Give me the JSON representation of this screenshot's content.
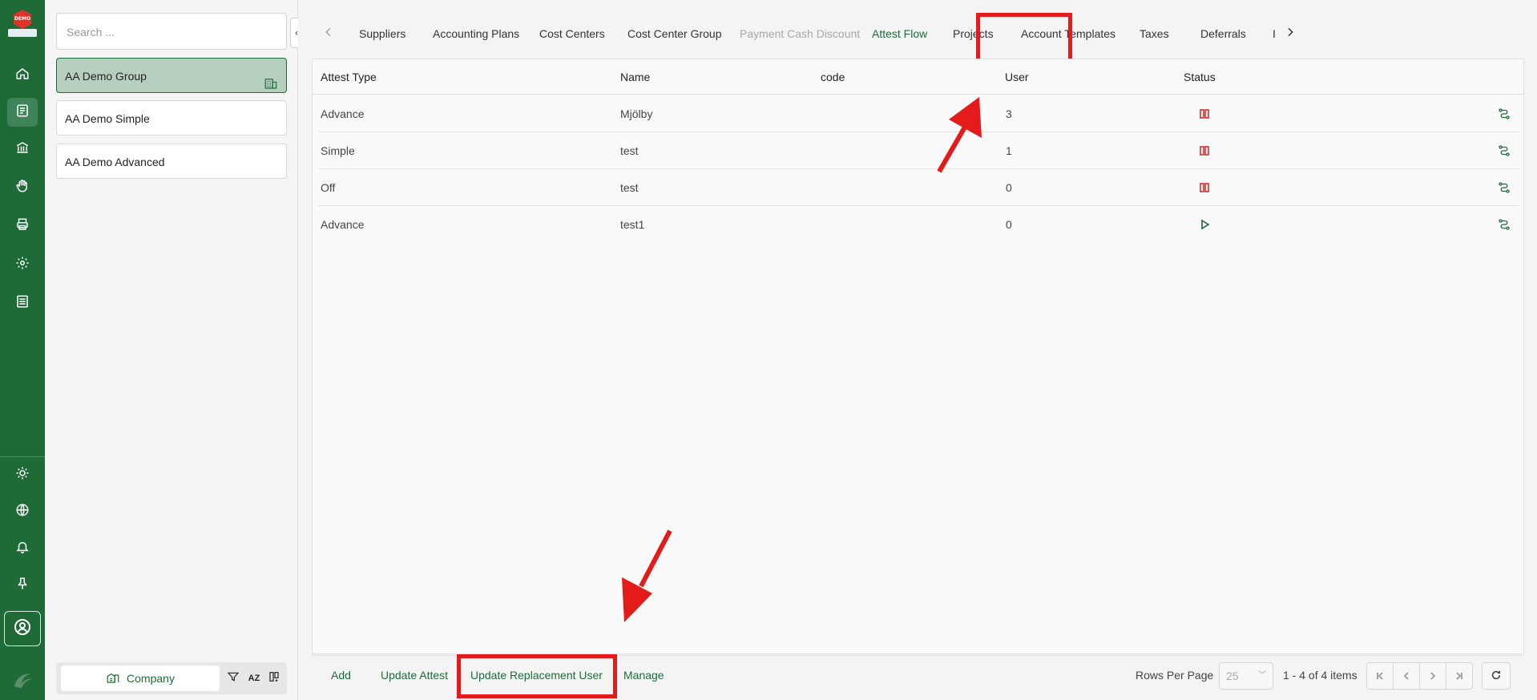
{
  "brand": {
    "logo_text": "DEMO"
  },
  "colors": {
    "brand_green": "#1f6b38",
    "status_off": "#d32f2f",
    "annotation_red": "#e31b1b"
  },
  "nav": {
    "icons": [
      "home-icon",
      "document-icon",
      "bank-icon",
      "hand-icon",
      "printer-icon",
      "gear-icon",
      "list-icon"
    ],
    "bottom_icons": [
      "sun-icon",
      "globe-icon",
      "bell-icon",
      "pin-icon",
      "user-circle-icon",
      "brand-swirl-icon"
    ],
    "active_index": 1
  },
  "sidebar": {
    "search_placeholder": "Search ...",
    "companies": [
      {
        "label": "AA Demo Group",
        "selected": true
      },
      {
        "label": "AA Demo Simple",
        "selected": false
      },
      {
        "label": "AA Demo Advanced",
        "selected": false
      }
    ],
    "footer": {
      "company_label": "Company",
      "sort_label": "AZ"
    }
  },
  "tabs": {
    "items": [
      {
        "label": "Suppliers"
      },
      {
        "label": "Accounting Plans"
      },
      {
        "label": "Cost Centers"
      },
      {
        "label": "Cost Center Group"
      },
      {
        "label": "Payment Cash Discount",
        "disabled": true
      },
      {
        "label": "Attest Flow",
        "active": true
      },
      {
        "label": "Projects"
      },
      {
        "label": "Account Templates"
      },
      {
        "label": "Taxes"
      },
      {
        "label": "Deferrals"
      },
      {
        "label": "I"
      }
    ]
  },
  "grid": {
    "columns": [
      "Attest Type",
      "Name",
      "code",
      "User",
      "Status"
    ],
    "rows": [
      {
        "attest_type": "Advance",
        "name": "Mjölby",
        "code": "",
        "user": "3",
        "status": "paused"
      },
      {
        "attest_type": "Simple",
        "name": "test",
        "code": "",
        "user": "1",
        "status": "paused"
      },
      {
        "attest_type": "Off",
        "name": "test",
        "code": "",
        "user": "0",
        "status": "paused"
      },
      {
        "attest_type": "Advance",
        "name": "test1",
        "code": "",
        "user": "0",
        "status": "active"
      }
    ]
  },
  "actions": {
    "add": "Add",
    "update_attest": "Update Attest",
    "update_replacement_user": "Update Replacement User",
    "manage": "Manage"
  },
  "pager": {
    "rows_per_page_label": "Rows Per Page",
    "rows_per_page_value": "25",
    "summary": "1 - 4 of 4 items"
  }
}
